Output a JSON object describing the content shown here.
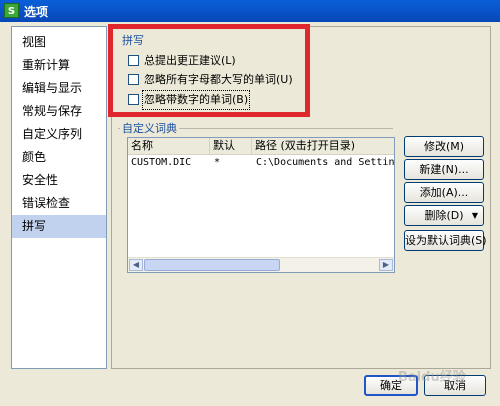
{
  "window": {
    "title": "选项",
    "app_icon_glyph": "S"
  },
  "sidebar": {
    "items": [
      {
        "label": "视图"
      },
      {
        "label": "重新计算"
      },
      {
        "label": "编辑与显示"
      },
      {
        "label": "常规与保存"
      },
      {
        "label": "自定义序列"
      },
      {
        "label": "颜色"
      },
      {
        "label": "安全性"
      },
      {
        "label": "错误检查"
      },
      {
        "label": "拼写",
        "selected": true
      }
    ]
  },
  "spelling": {
    "section_title": "拼写",
    "options": [
      {
        "label": "总提出更正建议(L)",
        "checked": false
      },
      {
        "label": "忽略所有字母都大写的单词(U)",
        "checked": false
      },
      {
        "label": "忽略带数字的单词(B)",
        "checked": false
      }
    ]
  },
  "custom_dict": {
    "section_title": "自定义词典",
    "columns": [
      "名称",
      "默认",
      "路径 (双击打开目录)"
    ],
    "rows": [
      [
        "CUSTOM.DIC",
        "*",
        "C:\\Documents and Setting"
      ]
    ]
  },
  "buttons": {
    "modify": "修改(M)",
    "new": "新建(N)...",
    "add": "添加(A)...",
    "delete": "删除(D)",
    "set_default": "设为默认词典(S)",
    "ok": "确定",
    "cancel": "取消"
  },
  "watermark": "Baidu经验",
  "colors": {
    "highlight_box": "#e0282c",
    "title_bar": "#0a5fd8",
    "selected_item": "#c1d2ee"
  }
}
